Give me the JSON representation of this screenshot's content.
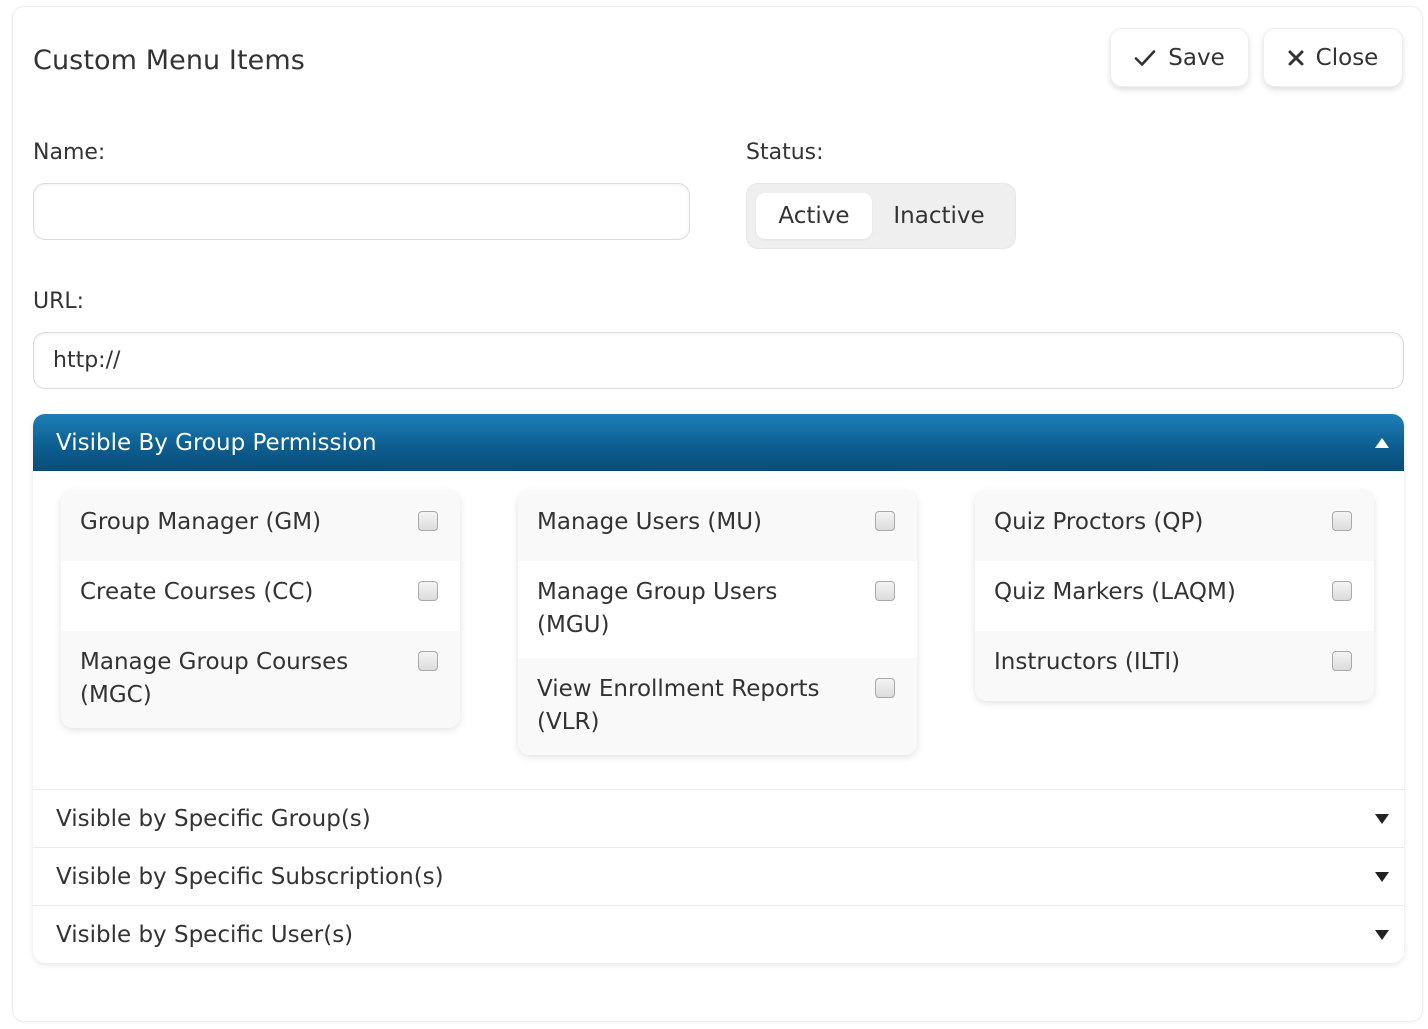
{
  "header": {
    "title": "Custom Menu Items",
    "save_label": "Save",
    "close_label": "Close",
    "save_icon": "check-icon",
    "close_icon": "x-icon"
  },
  "form": {
    "name_label": "Name:",
    "name_value": "",
    "status_label": "Status:",
    "status_options": [
      "Active",
      "Inactive"
    ],
    "status_selected": "Active",
    "url_label": "URL:",
    "url_value": "http://"
  },
  "sections": {
    "group_permission": {
      "title": "Visible By Group Permission",
      "expanded": true,
      "columns": [
        [
          {
            "label": "Group Manager (GM)",
            "checked": false
          },
          {
            "label": "Create Courses (CC)",
            "checked": false
          },
          {
            "label": "Manage Group Courses (MGC)",
            "checked": false
          }
        ],
        [
          {
            "label": "Manage Users (MU)",
            "checked": false
          },
          {
            "label": "Manage Group Users (MGU)",
            "checked": false
          },
          {
            "label": "View Enrollment Reports (VLR)",
            "checked": false
          }
        ],
        [
          {
            "label": "Quiz Proctors (QP)",
            "checked": false
          },
          {
            "label": "Quiz Markers (LAQM)",
            "checked": false
          },
          {
            "label": "Instructors (ILTI)",
            "checked": false
          }
        ]
      ]
    },
    "collapsed": [
      {
        "title": "Visible by Specific Group(s)",
        "expanded": false
      },
      {
        "title": "Visible by Specific Subscription(s)",
        "expanded": false
      },
      {
        "title": "Visible by Specific User(s)",
        "expanded": false
      }
    ]
  },
  "colors": {
    "accent_header": "#0d5f92",
    "text": "#333333"
  }
}
